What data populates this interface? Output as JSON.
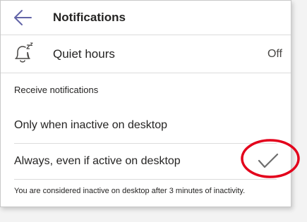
{
  "header": {
    "title": "Notifications",
    "back_icon": "arrow-left-icon"
  },
  "quiet_hours": {
    "label": "Quiet hours",
    "value": "Off",
    "icon": "bell-snooze-icon"
  },
  "receive_section": {
    "label": "Receive notifications",
    "options": [
      {
        "label": "Only when inactive on desktop",
        "selected": false
      },
      {
        "label": "Always, even if active on desktop",
        "selected": true
      }
    ],
    "footnote": "You are considered inactive on desktop after 3 minutes of inactivity."
  },
  "colors": {
    "accent": "#6264a7",
    "annotation": "#e3001b",
    "check": "#6e6e6e"
  }
}
